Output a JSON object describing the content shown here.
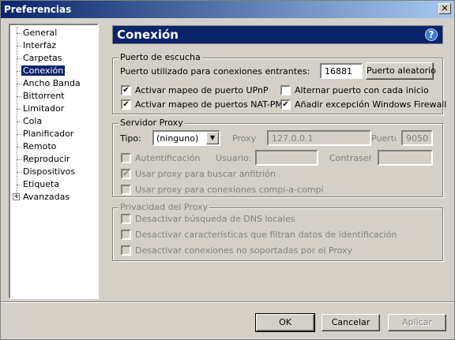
{
  "window": {
    "title": "Preferencias",
    "close_label": "✕"
  },
  "tree": {
    "items": [
      {
        "label": "General"
      },
      {
        "label": "Interfaz"
      },
      {
        "label": "Carpetas"
      },
      {
        "label": "Conexión",
        "selected": true
      },
      {
        "label": "Ancho Banda"
      },
      {
        "label": "Bittorrent"
      },
      {
        "label": "Limitador"
      },
      {
        "label": "Cola"
      },
      {
        "label": "Planificador"
      },
      {
        "label": "Remoto"
      },
      {
        "label": "Reproducir"
      },
      {
        "label": "Dispositivos"
      },
      {
        "label": "Etiqueta"
      },
      {
        "label": "Avanzadas",
        "expander": "+"
      }
    ]
  },
  "header": {
    "title": "Conexión",
    "help_icon": "?"
  },
  "listen": {
    "title": "Puerto de escucha",
    "port_label": "Puerto utilizado para conexiones entrantes:",
    "port_value": "16881",
    "random_button": "Puerto aleatorio",
    "upnp": {
      "label": "Activar mapeo de puerto UPnP",
      "checked": true,
      "mark": "✔"
    },
    "natpmp": {
      "label": "Activar mapeo de puertos NAT-PMP",
      "checked": true,
      "mark": "✔"
    },
    "alternate": {
      "label": "Alternar puerto con cada inicio",
      "checked": false,
      "mark": ""
    },
    "firewall": {
      "label": "Añadir excepción Windows Firewall",
      "checked": true,
      "mark": "✔"
    }
  },
  "proxy": {
    "title": "Servidor Proxy",
    "type_label": "Tipo:",
    "type_value": "(ninguno)",
    "type_arrow": "▼",
    "proxy_label": "Proxy",
    "proxy_value": "127.0.0.1",
    "port_label": "Puerto",
    "port_value": "9050",
    "auth_label": "Autentificación",
    "auth_mark": "",
    "user_label": "Usuario:",
    "password_label": "Contraseña:",
    "hostname_label": "Usar proxy para buscar anfitrión",
    "hostname_mark": "✔",
    "p2p_label": "Usar proxy para conexiones compi-a-compi",
    "p2p_mark": ""
  },
  "privacy": {
    "title": "Privacidad del Proxy",
    "dns_label": "Desactivar búsqueda de DNS locales",
    "dns_mark": "",
    "ident_label": "Desactivar características que filtran datos de identificación",
    "ident_mark": "",
    "unsupported_label": "Desactivar conexiones no soportadas por el Proxy",
    "unsupported_mark": ""
  },
  "buttons": {
    "ok": "OK",
    "cancel": "Cancelar",
    "apply": "Aplicar"
  }
}
